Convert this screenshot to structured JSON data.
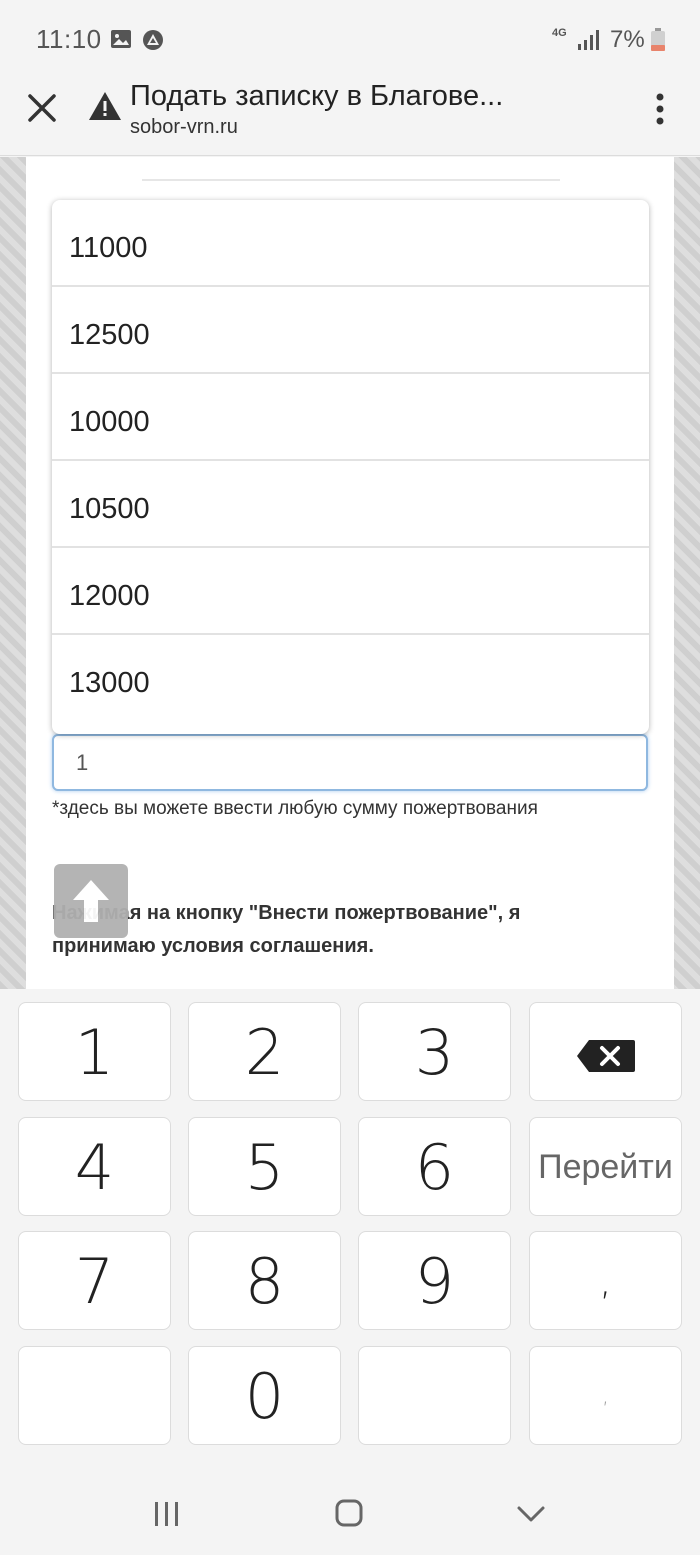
{
  "status_bar": {
    "time": "11:10",
    "network": "4G",
    "battery": "7%"
  },
  "header": {
    "title": "Подать записку в Благове...",
    "url": "sobor-vrn.ru"
  },
  "dropdown": {
    "options": [
      "11000",
      "12500",
      "10000",
      "10500",
      "12000",
      "13000"
    ]
  },
  "form": {
    "amount_value": "1",
    "hint": "*здесь вы можете ввести любую сумму пожертвования",
    "terms_line1": "Нажимая на кнопку \"Внести пожертвование\", я",
    "terms_line2": "принимаю условия соглашения."
  },
  "keyboard": {
    "rows": [
      [
        "1",
        "2",
        "3",
        "⌫"
      ],
      [
        "4",
        "5",
        "6",
        "Перейти"
      ],
      [
        "7",
        "8",
        "9",
        ","
      ],
      [
        "",
        "0",
        "",
        ","
      ]
    ]
  },
  "colors": {
    "accent_focus": "#8fb8e0",
    "battery_low": "#e8836b"
  }
}
